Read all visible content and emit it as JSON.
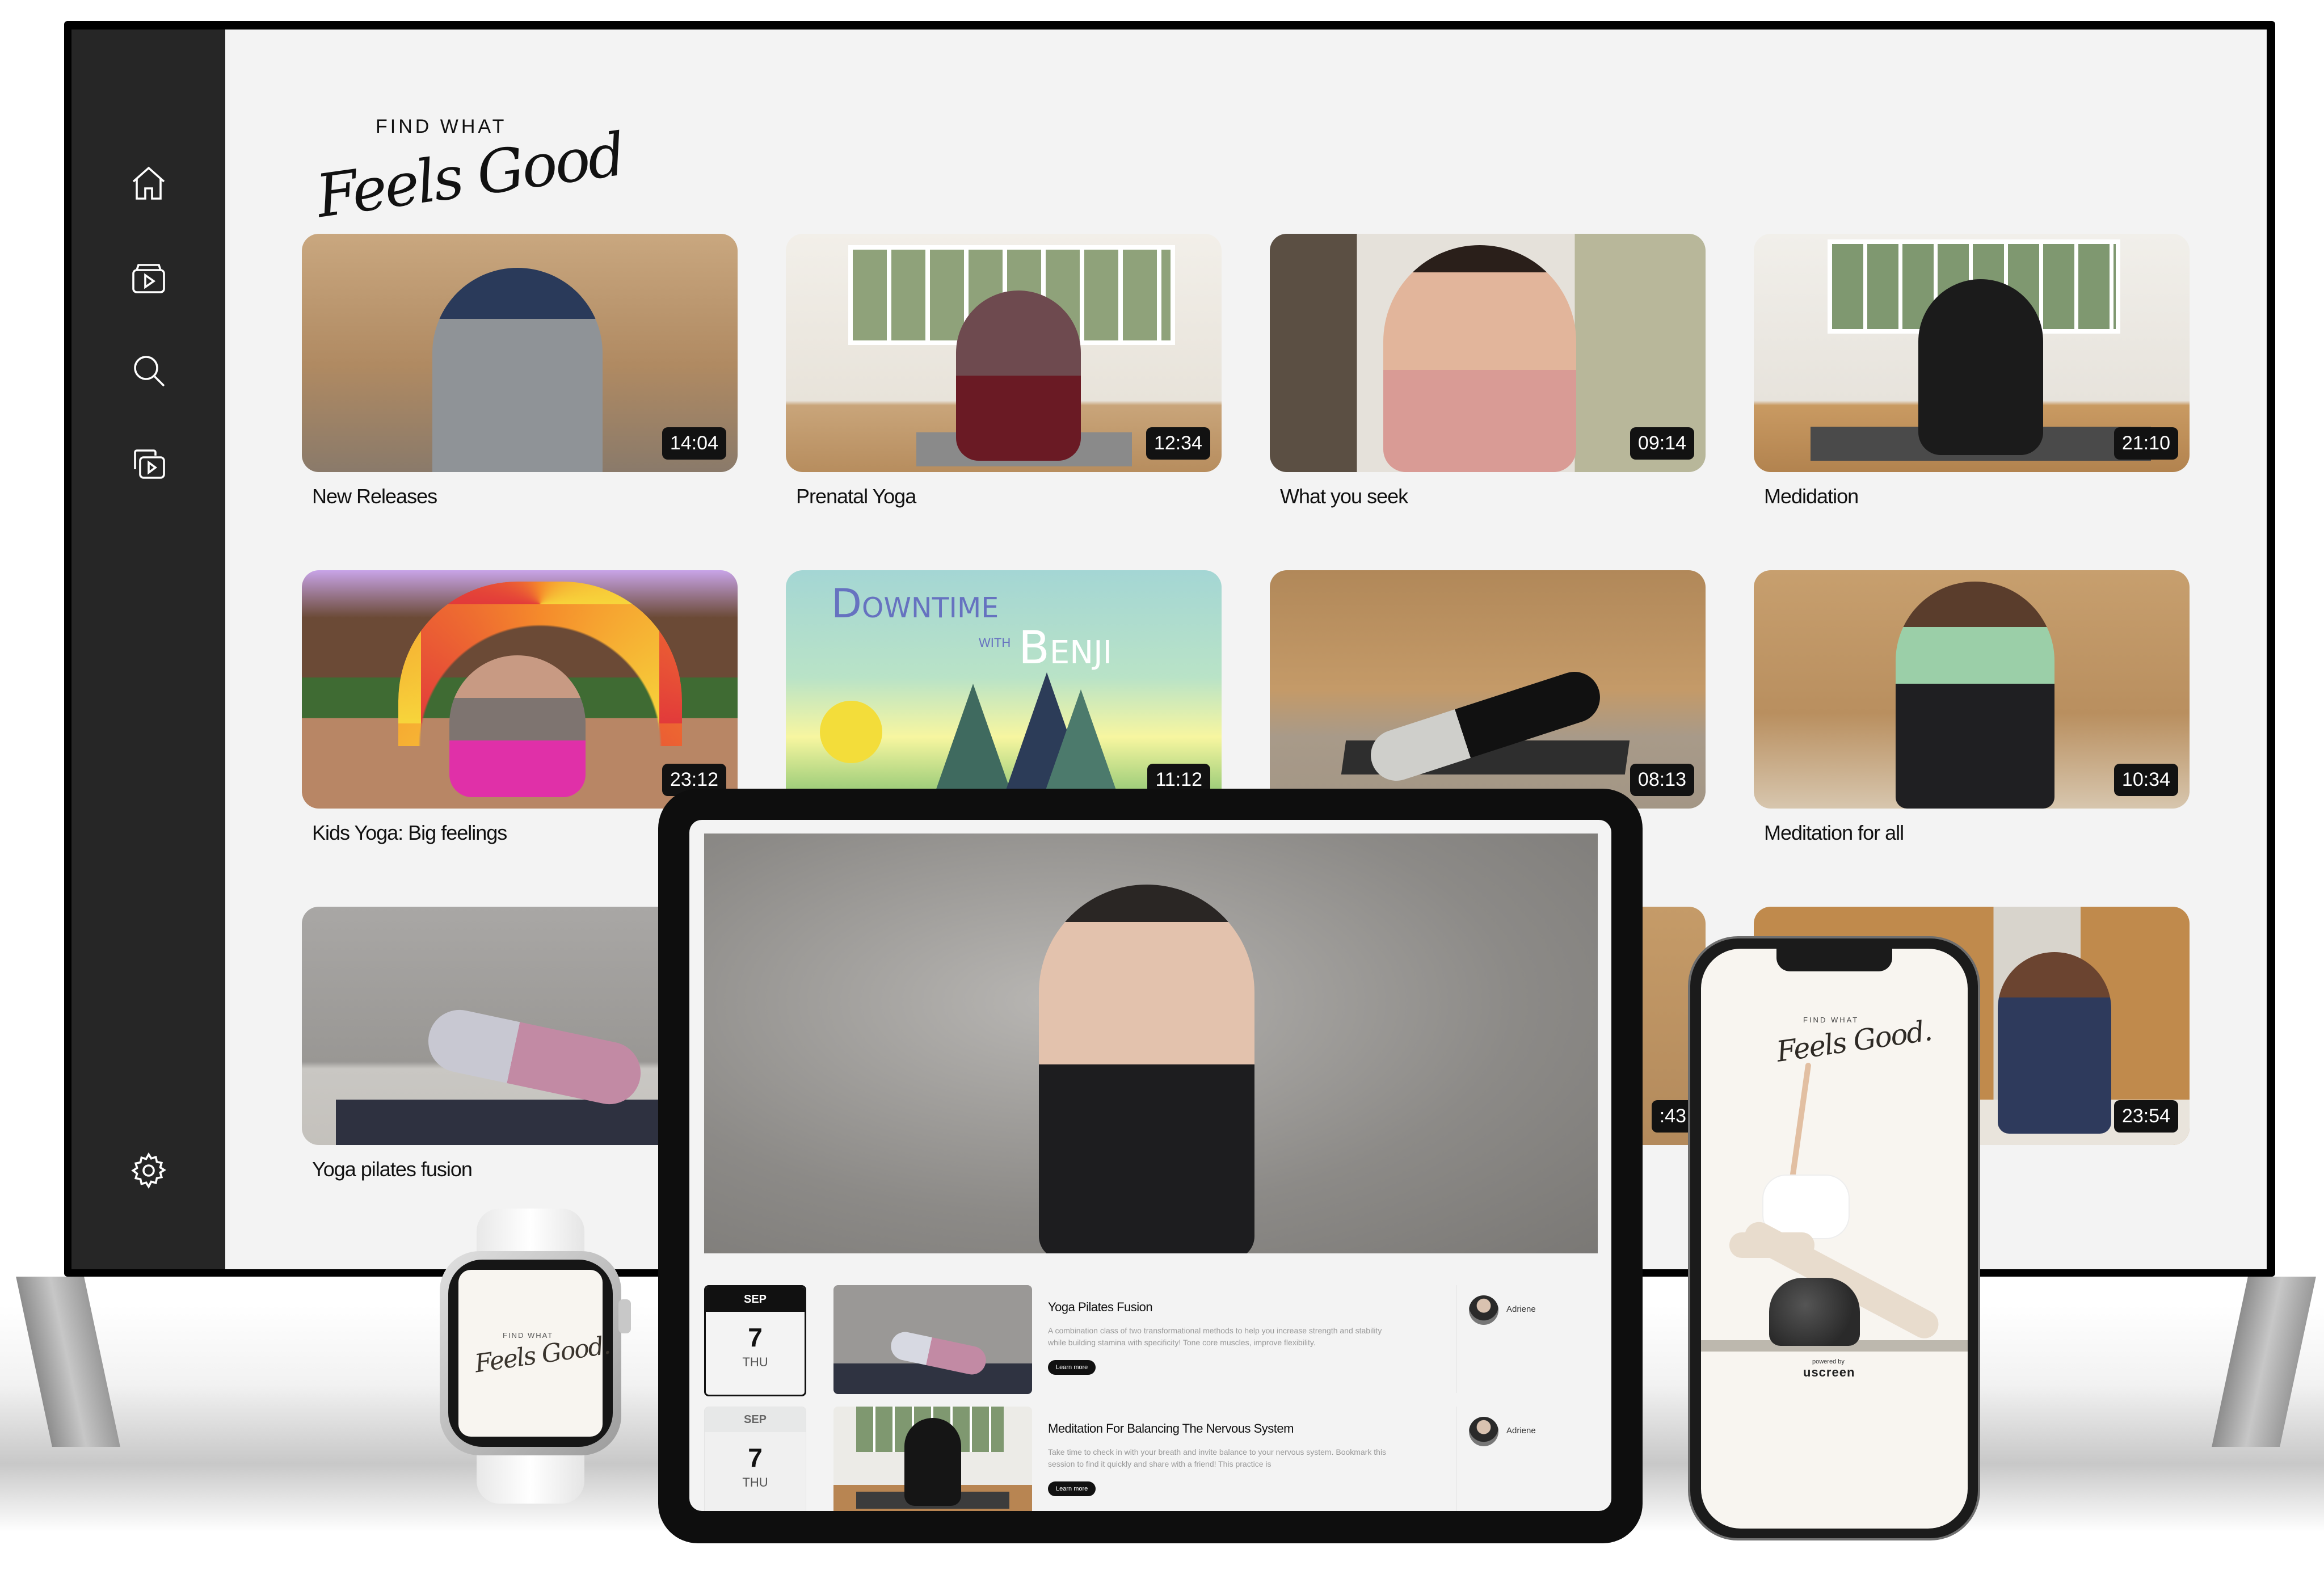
{
  "tv": {
    "sidebar": {
      "items": [
        {
          "icon": "home-icon",
          "label": "Home"
        },
        {
          "icon": "video-library-icon",
          "label": "Library"
        },
        {
          "icon": "search-icon",
          "label": "Search"
        },
        {
          "icon": "playlists-icon",
          "label": "Playlists"
        }
      ],
      "settings_icon": "gear-icon"
    },
    "logo": {
      "small": "FIND WHAT",
      "script": "Feels Good"
    },
    "cards": [
      {
        "title": "New Releases",
        "duration": "14:04"
      },
      {
        "title": "Prenatal Yoga",
        "duration": "12:34"
      },
      {
        "title": "What you seek",
        "duration": "09:14"
      },
      {
        "title": "Medidation",
        "duration": "21:10"
      },
      {
        "title": "Kids Yoga: Big feelings",
        "duration": "23:12"
      },
      {
        "title": "",
        "duration": "11:12",
        "art_title": "Downtime",
        "art_with": "with",
        "art_name": "Benji"
      },
      {
        "title": "",
        "duration": "08:13"
      },
      {
        "title": "Meditation for all",
        "duration": "10:34"
      },
      {
        "title": "Yoga pilates fusion",
        "duration": ""
      },
      {
        "title": "",
        "duration": ""
      },
      {
        "title": "",
        "duration": ":43"
      },
      {
        "title": "",
        "duration": "23:54"
      }
    ]
  },
  "tablet": {
    "events": [
      {
        "month": "SEP",
        "day": "7",
        "weekday": "THU",
        "title": "Yoga Pilates Fusion",
        "description": "A combination class of two transformational methods to help you increase strength and stability while building stamina with specificity! Tone core muscles, improve flexibility.",
        "button": "Learn more",
        "author": "Adriene",
        "selected": true
      },
      {
        "month": "SEP",
        "day": "7",
        "weekday": "THU",
        "title": "Meditation For Balancing The Nervous System",
        "description": "Take time to check in with your breath and invite balance to your nervous system. Bookmark this session to find it quickly and share with a friend! This practice is",
        "button": "Learn more",
        "author": "Adriene",
        "selected": false
      }
    ]
  },
  "phone": {
    "logo_small": "FIND WHAT",
    "logo_script": "Feels Good.",
    "powered_by": "powered by",
    "brand": "uscreen"
  },
  "watch": {
    "logo_small": "FIND WHAT",
    "logo_script": "Feels Good."
  },
  "colors": {
    "sidebar": "#262626",
    "screen_bg": "#f3f3f3",
    "badge": "#121212",
    "app_bg": "#f8f5f0"
  }
}
